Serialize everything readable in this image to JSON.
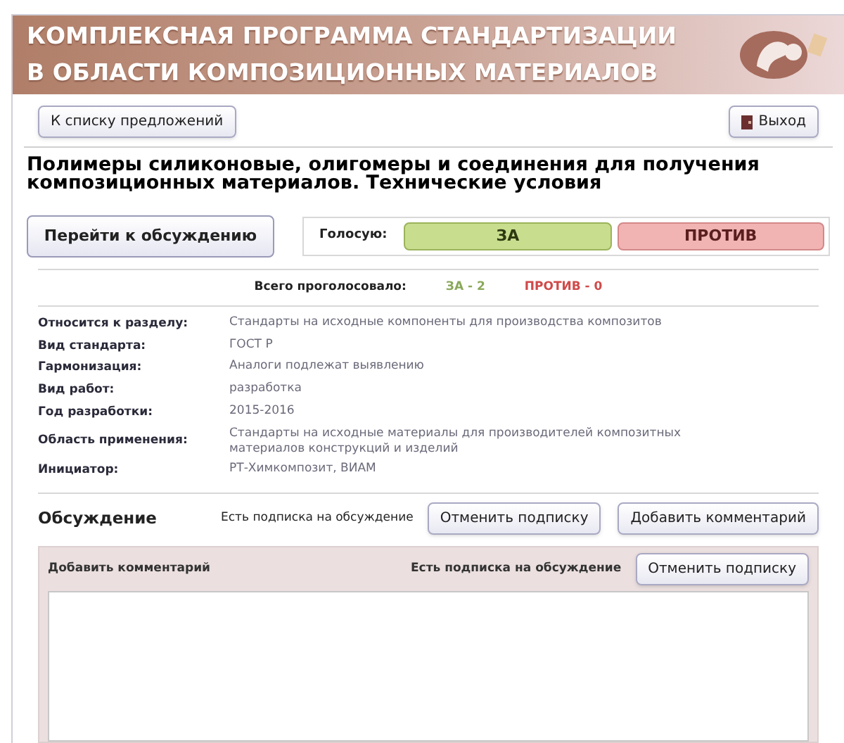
{
  "header": {
    "title_line_1": "КОМПЛЕКСНАЯ ПРОГРАММА СТАНДАРТИЗАЦИИ",
    "title_line_2": "В ОБЛАСТИ КОМПОЗИЦИОННЫХ МАТЕРИАЛОВ"
  },
  "toolbar": {
    "back_button": "К списку предложений",
    "exit_button": "Выход"
  },
  "page_title": "Полимеры силиконовые, олигомеры и соединения для получения композиционных материалов. Технические условия",
  "discuss_button": "Перейти к обсуждению",
  "vote": {
    "label": "Голосую:",
    "options": [
      {
        "kind": "for",
        "label": "ЗА"
      },
      {
        "kind": "against",
        "label": "ПРОТИВ"
      }
    ]
  },
  "totals": {
    "label": "Всего проголосовало:",
    "counts": [
      {
        "kind": "for",
        "text": "ЗА - 2"
      },
      {
        "kind": "against",
        "text": "ПРОТИВ - 0"
      }
    ]
  },
  "details": [
    {
      "label": "Относится к разделу:",
      "value": "Стандарты на исходные компоненты для производства композитов"
    },
    {
      "label": "Вид стандарта:",
      "value": "ГОСТ Р"
    },
    {
      "label": "Гармонизация:",
      "value": "Аналоги подлежат выявлению"
    },
    {
      "label": "Вид работ:",
      "value": "разработка"
    },
    {
      "label": "Год разработки:",
      "value": "2015-2016"
    },
    {
      "label": "Область применения:",
      "value": "Стандарты на исходные материалы для производителей композитных материалов конструкций и изделий"
    },
    {
      "label": "Инициатор:",
      "value": "РТ-Химкомпозит, ВИАМ"
    }
  ],
  "discussion": {
    "title": "Обсуждение",
    "subscription_note": "Есть подписка на обсуждение",
    "unsubscribe_button": "Отменить подписку",
    "add_comment_button": "Добавить комментарий"
  },
  "comment_panel": {
    "title": "Добавить комментарий",
    "subscription_note": "Есть подписка на обсуждение",
    "unsubscribe_button": "Отменить подписку"
  }
}
